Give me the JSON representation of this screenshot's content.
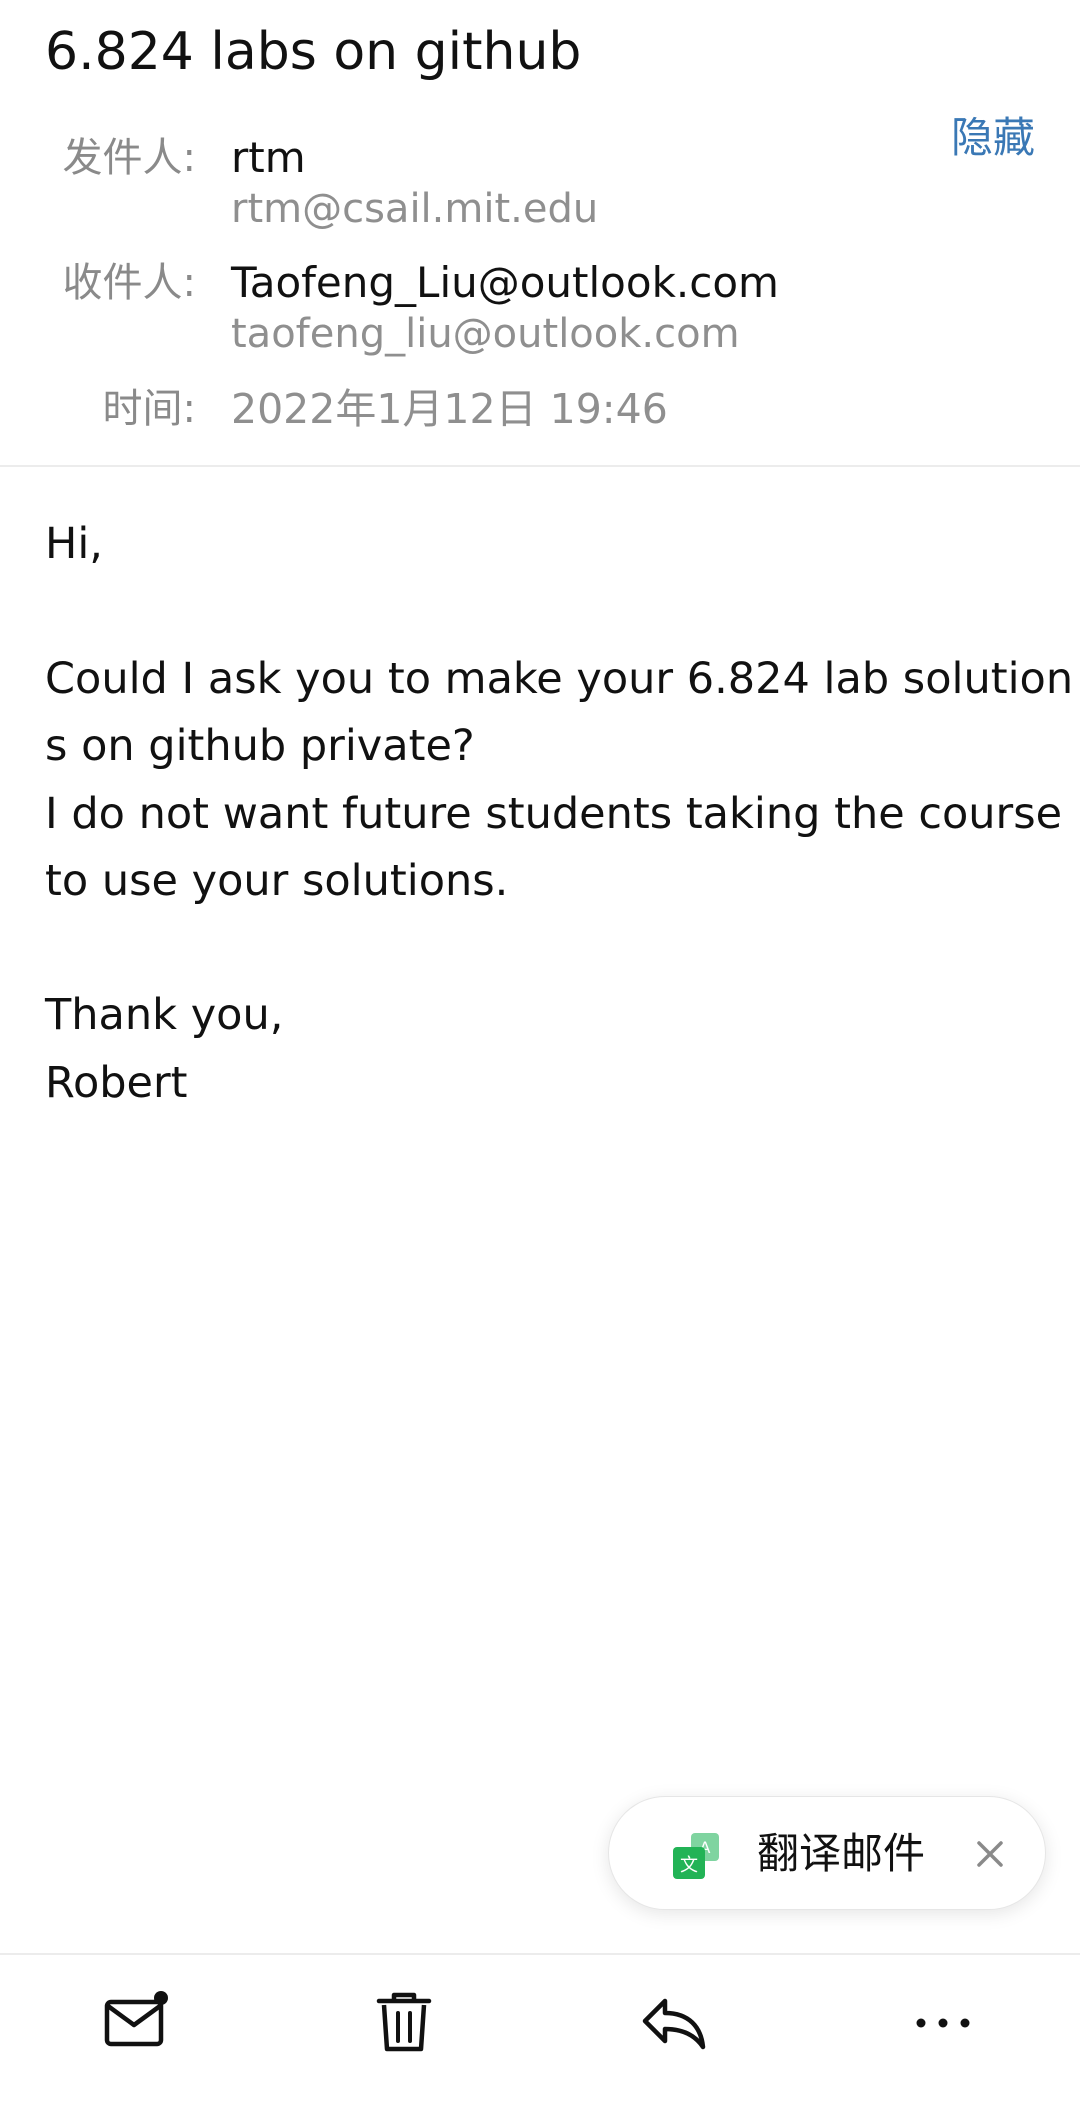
{
  "email": {
    "subject": "6.824 labs on github",
    "hide_label": "隐藏",
    "from_label": "发件人:",
    "from_name": "rtm",
    "from_address": "rtm@csail.mit.edu",
    "to_label": "收件人:",
    "to_name": "Taofeng_Liu@outlook.com",
    "to_address": "taofeng_liu@outlook.com",
    "time_label": "时间:",
    "time_value": "2022年1月12日 19:46",
    "body_lines": [
      "Hi,",
      "Could I ask you to make your 6.824 lab solution",
      "s on github private?",
      "I do not want future students taking the course",
      "to use your solutions.",
      "Thank you,",
      "Robert"
    ]
  },
  "translate_popup": {
    "label": "翻译邮件",
    "icon": "translate-icon",
    "close_icon": "close-icon"
  },
  "toolbar": {
    "items": [
      {
        "icon": "mark-unread-mail-icon"
      },
      {
        "icon": "trash-icon"
      },
      {
        "icon": "reply-icon"
      },
      {
        "icon": "more-icon"
      }
    ]
  },
  "colors": {
    "accent": "#3a78b5",
    "secondary_text": "#8a8a8a",
    "translate_green": "#2bb35a"
  }
}
